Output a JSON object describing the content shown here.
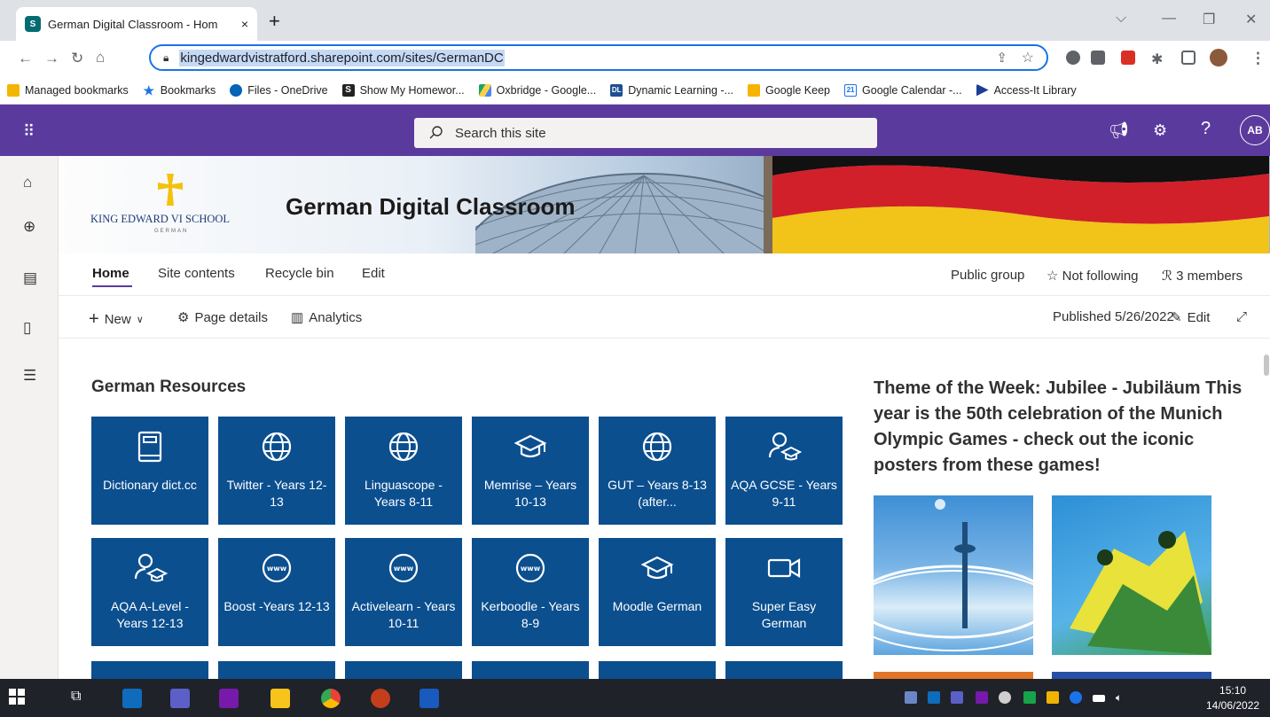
{
  "browser": {
    "tab_title": "German Digital Classroom - Hom",
    "tab_close": "×",
    "new_tab": "+",
    "url": "kingedwardvistratford.sharepoint.com/sites/GermanDC"
  },
  "bookmarks": [
    {
      "label": "Managed bookmarks",
      "color": "#f2b600",
      "glyph": ""
    },
    {
      "label": "Bookmarks",
      "color": "#1a73e8",
      "glyph": "★"
    },
    {
      "label": "Files - OneDrive",
      "color": "#0364b8",
      "glyph": ""
    },
    {
      "label": "Show My Homewor...",
      "color": "#222222",
      "glyph": "S"
    },
    {
      "label": "Oxbridge - Google...",
      "color": "#1fa463",
      "glyph": ""
    },
    {
      "label": "Dynamic Learning -...",
      "color": "#1d4f91",
      "glyph": "DL"
    },
    {
      "label": "Google Keep",
      "color": "#f6b400",
      "glyph": ""
    },
    {
      "label": "Google Calendar -...",
      "color": "#1a73e8",
      "glyph": "21"
    },
    {
      "label": "Access-It Library",
      "color": "#1c3f94",
      "glyph": ""
    }
  ],
  "suite": {
    "search_placeholder": "Search this site",
    "avatar_initials": "AB",
    "help": "?"
  },
  "site": {
    "title": "German Digital Classroom",
    "logo_text": "KING EDWARD VI SCHOOL",
    "logo_sub": "GERMAN"
  },
  "site_nav": {
    "items": [
      "Home",
      "Site contents",
      "Recycle bin",
      "Edit"
    ],
    "public_group": "Public group",
    "following": "Not following",
    "members": "3 members"
  },
  "command_bar": {
    "new": "New",
    "page_details": "Page details",
    "analytics": "Analytics",
    "published": "Published 5/26/2022",
    "edit": "Edit"
  },
  "resources": {
    "heading": "German Resources",
    "tiles": [
      {
        "label": "Dictionary dict.cc",
        "icon": "book-icon"
      },
      {
        "label": "Twitter - Years 12-13",
        "icon": "globe-icon"
      },
      {
        "label": "Linguascope - Years 8-11",
        "icon": "globe-icon"
      },
      {
        "label": "Memrise – Years 10-13",
        "icon": "mortarboard-icon"
      },
      {
        "label": "GUT – Years 8-13 (after...",
        "icon": "globe-icon"
      },
      {
        "label": "AQA GCSE - Years 9-11",
        "icon": "person-mortarboard-icon"
      },
      {
        "label": "AQA A-Level - Years 12-13",
        "icon": "person-mortarboard-icon"
      },
      {
        "label": "Boost -Years 12-13",
        "icon": "www-icon"
      },
      {
        "label": "Activelearn - Years 10-11",
        "icon": "www-icon"
      },
      {
        "label": "Kerboodle - Years 8-9",
        "icon": "www-icon"
      },
      {
        "label": "Moodle German",
        "icon": "mortarboard-icon"
      },
      {
        "label": "Super Easy German",
        "icon": "video-icon"
      }
    ]
  },
  "theme": {
    "text": "Theme of the Week: Jubilee - Jubiläum This year is the 50th celebration of the Munich Olympic Games - check out the iconic posters from these games!"
  },
  "taskbar": {
    "time": "15:10",
    "date": "14/06/2022"
  }
}
